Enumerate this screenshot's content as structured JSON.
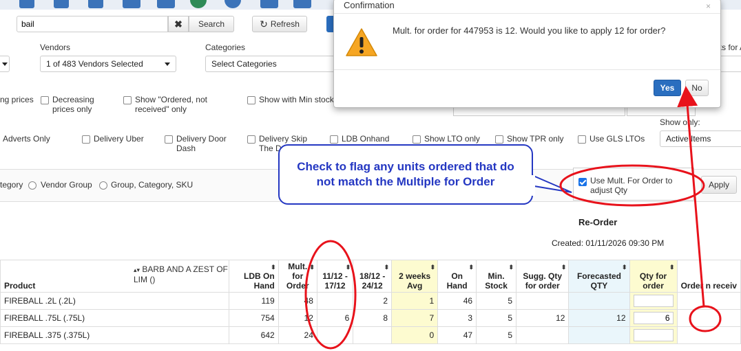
{
  "search": {
    "value": "bail",
    "clear_label": "✖",
    "button_label": "Search",
    "refresh_label": "Refresh"
  },
  "filters": {
    "vendors_label": "Vendors",
    "vendors_value": "1 of 483 Vendors Selected",
    "categories_label": "Categories",
    "categories_value": "Select Categories",
    "right_label_fragment": "ks for A",
    "show_only_label": "Show only:",
    "show_only_value": "Active Items"
  },
  "checkboxes_row1": [
    {
      "label": "ng prices"
    },
    {
      "label": "Decreasing prices only"
    },
    {
      "label": "Show \"Ordered, not received\" only"
    },
    {
      "label": "Show with Min stock"
    }
  ],
  "checkboxes_row2": [
    {
      "label": "Adverts Only"
    },
    {
      "label": "Delivery Uber"
    },
    {
      "label": "Delivery Door Dash"
    },
    {
      "label": "Delivery Skip The D..."
    },
    {
      "label": "LDB Onhand"
    },
    {
      "label": "Show LTO only"
    },
    {
      "label": "Show TPR only"
    },
    {
      "label": "Use GLS LTOs"
    }
  ],
  "grouping": {
    "category_fragment": "tegory",
    "vendor_group": "Vendor Group",
    "group_category_sku": "Group, Category, SKU",
    "mult_label": "Use Mult. For Order to adjust Qty",
    "apply_label": "Apply"
  },
  "dialog": {
    "title": "Confirmation",
    "close": "×",
    "message": "Mult. for order for 447953 is 12. Would you like to apply 12 for order?",
    "yes_label": "Yes",
    "no_label": "No"
  },
  "callout": {
    "text": "Check to flag any units ordered that do not match the Multiple for Order"
  },
  "report": {
    "title": "Re-Order",
    "created": "Created: 01/11/2026 09:30 PM",
    "group_header": "BARB AND A ZEST OF LIM ()",
    "columns": [
      "Product",
      "LDB On Hand",
      "Mult. for Order",
      "11/12 - 17/12",
      "18/12 - 24/12",
      "2 weeks Avg",
      "On Hand",
      "Min. Stock",
      "Sugg. Qty for order",
      "Forecasted QTY",
      "Qty for order",
      "Order n receiv"
    ],
    "rows": [
      {
        "product": "FIREBALL .2L (.2L)",
        "ldb": "119",
        "mult": "48",
        "w1": "",
        "w2": "2",
        "avg": "1",
        "onhand": "46",
        "min": "5",
        "sugg": "",
        "forecast": "",
        "qty": ""
      },
      {
        "product": "FIREBALL .75L (.75L)",
        "ldb": "754",
        "mult": "12",
        "w1": "6",
        "w2": "8",
        "avg": "7",
        "onhand": "3",
        "min": "5",
        "sugg": "12",
        "forecast": "12",
        "qty": "6"
      },
      {
        "product": "FIREBALL .375 (.375L)",
        "ldb": "642",
        "mult": "24",
        "w1": "",
        "w2": "",
        "avg": "0",
        "onhand": "47",
        "min": "5",
        "sugg": "",
        "forecast": "",
        "qty": ""
      }
    ]
  },
  "colors": {
    "annotation_red": "#e8121b",
    "callout_blue": "#2437c2",
    "primary_button": "#2a6ebf"
  }
}
